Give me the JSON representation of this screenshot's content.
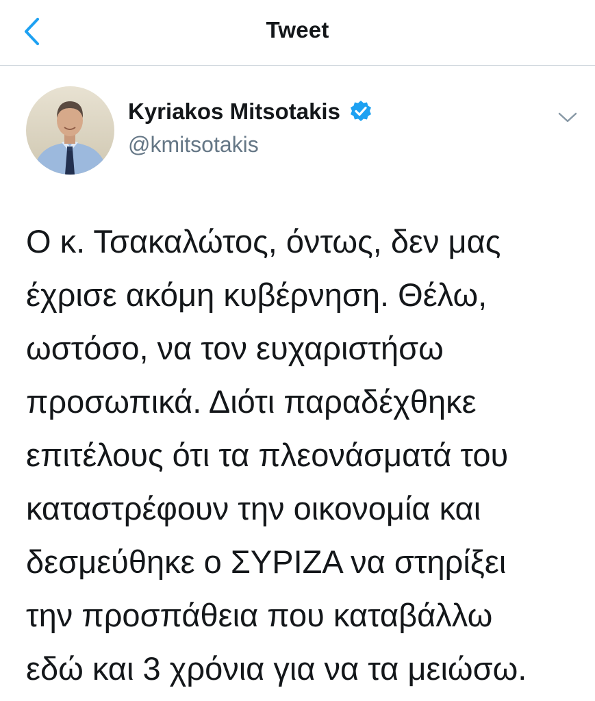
{
  "nav": {
    "title": "Tweet",
    "back_icon": "chevron-left-icon"
  },
  "author": {
    "name": "Kyriakos Mitsotakis",
    "handle": "@kmitsotakis",
    "verified_icon": "verified-badge-icon"
  },
  "tweet": {
    "lines": [
      "Ο κ. Τσακαλώτος, όντως, δεν μας",
      "έχρισε ακόμη κυβέρνηση. Θέλω,",
      "ωστόσο, να τον ευχαριστήσω",
      "προσωπικά. Διότι παραδέχθηκε",
      "επιτέλους ότι τα πλεονάσματά του",
      "καταστρέφουν την οικονομία και",
      "δεσμεύθηκε ο ΣΥΡΙΖΑ να στηρίξει",
      "την προσπάθεια που καταβάλλω",
      "εδώ και 3 χρόνια για να τα μειώσω."
    ]
  },
  "colors": {
    "accent": "#1da1f2",
    "handle": "#657786",
    "text": "#14171a",
    "divider": "#cfd6dc"
  }
}
